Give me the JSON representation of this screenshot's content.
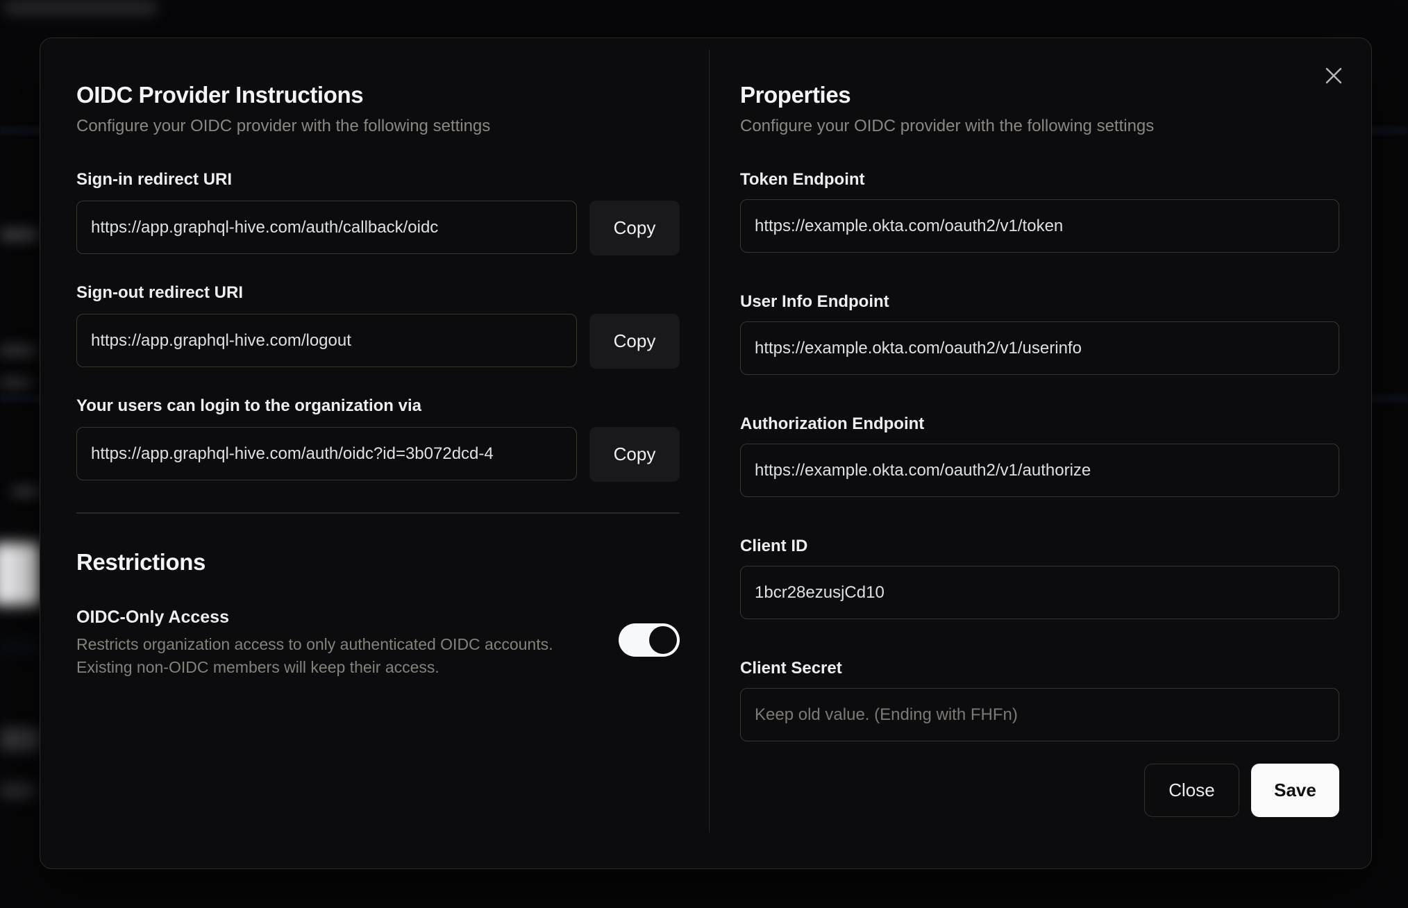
{
  "modal": {
    "left": {
      "title": "OIDC Provider Instructions",
      "subtitle": "Configure your OIDC provider with the following settings",
      "fields": [
        {
          "label": "Sign-in redirect URI",
          "value": "https://app.graphql-hive.com/auth/callback/oidc",
          "copy_label": "Copy"
        },
        {
          "label": "Sign-out redirect URI",
          "value": "https://app.graphql-hive.com/logout",
          "copy_label": "Copy"
        },
        {
          "label": "Your users can login to the organization via",
          "value": "https://app.graphql-hive.com/auth/oidc?id=3b072dcd-4",
          "copy_label": "Copy"
        }
      ],
      "restrictions": {
        "title": "Restrictions",
        "toggle_label": "OIDC-Only Access",
        "toggle_description_line1": "Restricts organization access to only authenticated OIDC accounts.",
        "toggle_description_line2": "Existing non-OIDC members will keep their access.",
        "toggle_state": "on"
      }
    },
    "right": {
      "title": "Properties",
      "subtitle": "Configure your OIDC provider with the following settings",
      "fields": [
        {
          "label": "Token Endpoint",
          "value": "https://example.okta.com/oauth2/v1/token"
        },
        {
          "label": "User Info Endpoint",
          "value": "https://example.okta.com/oauth2/v1/userinfo"
        },
        {
          "label": "Authorization Endpoint",
          "value": "https://example.okta.com/oauth2/v1/authorize"
        },
        {
          "label": "Client ID",
          "value": "1bcr28ezusjCd10"
        },
        {
          "label": "Client Secret",
          "value": "",
          "placeholder": "Keep old value. (Ending with FHFn)"
        }
      ],
      "buttons": {
        "close": "Close",
        "save": "Save"
      }
    },
    "colors": {
      "modal_background": "#0c0c0f",
      "overlay_background": "#070709",
      "input_border": "#3a3731",
      "accent_button_background": "#fafafa",
      "accent_button_text": "#101013",
      "muted_text": "#8b8881",
      "toggle_on_track": "#f7f8f9"
    }
  }
}
